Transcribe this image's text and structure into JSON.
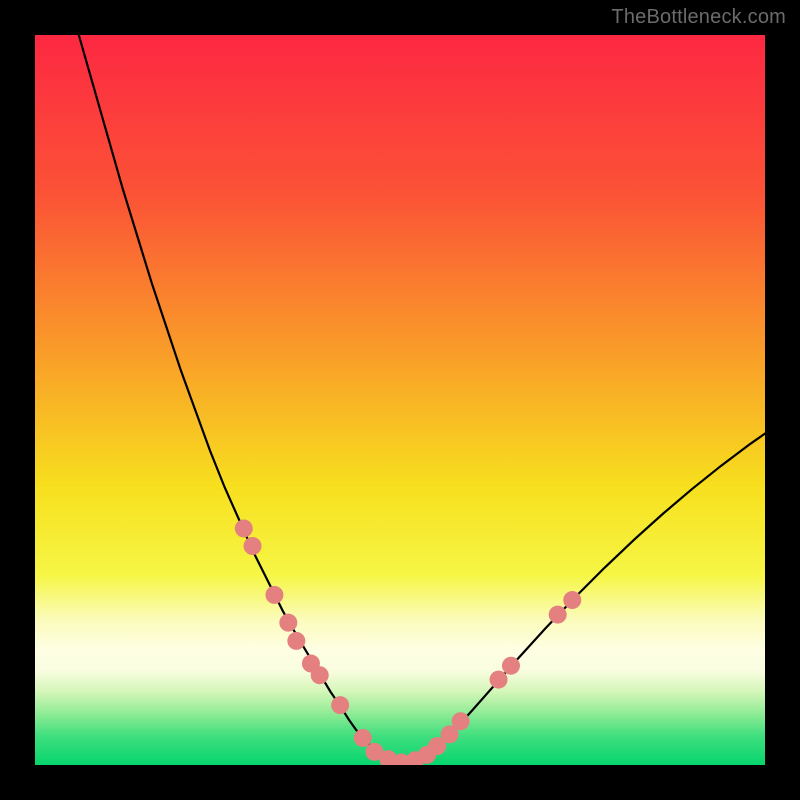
{
  "watermark": "TheBottleneck.com",
  "chart_data": {
    "type": "line",
    "title": "",
    "xlabel": "",
    "ylabel": "",
    "xlim": [
      0,
      100
    ],
    "ylim": [
      0,
      100
    ],
    "grid": false,
    "legend": false,
    "background_gradient": {
      "stops": [
        {
          "offset": 0.0,
          "color": "#fd2842"
        },
        {
          "offset": 0.22,
          "color": "#fb5336"
        },
        {
          "offset": 0.45,
          "color": "#f9a228"
        },
        {
          "offset": 0.62,
          "color": "#f7e01e"
        },
        {
          "offset": 0.74,
          "color": "#f6f646"
        },
        {
          "offset": 0.8,
          "color": "#fbfbba"
        },
        {
          "offset": 0.84,
          "color": "#fefee2"
        },
        {
          "offset": 0.87,
          "color": "#fafde0"
        },
        {
          "offset": 0.9,
          "color": "#d3f6b7"
        },
        {
          "offset": 0.93,
          "color": "#8eeb95"
        },
        {
          "offset": 0.96,
          "color": "#40df7e"
        },
        {
          "offset": 1.0,
          "color": "#06d56e"
        }
      ]
    },
    "series": [
      {
        "name": "bottleneck-curve",
        "color": "#000000",
        "width": 2.2,
        "x": [
          6,
          8,
          10,
          12,
          14,
          16,
          18,
          20,
          22,
          24,
          26,
          28,
          30,
          32,
          34,
          36,
          37.5,
          39,
          40.5,
          42,
          43,
          44,
          45,
          46,
          47,
          48,
          50,
          52,
          54,
          56,
          58,
          60,
          63,
          66,
          70,
          74,
          78,
          82,
          86,
          90,
          94,
          98,
          100
        ],
        "y": [
          100,
          93,
          86,
          79,
          72.5,
          66,
          60,
          54,
          48.5,
          43,
          38,
          33.5,
          29,
          25,
          21,
          17.5,
          15,
          12.5,
          10,
          7.8,
          6.2,
          4.8,
          3.6,
          2.6,
          1.8,
          1.1,
          0.35,
          0.6,
          1.7,
          3.4,
          5.4,
          7.6,
          11,
          14.4,
          18.8,
          23,
          27,
          30.8,
          34.4,
          37.8,
          41,
          44,
          45.4
        ]
      }
    ],
    "markers": {
      "name": "highlight-dots",
      "color": "#e48080",
      "radius": 9,
      "points": [
        {
          "x": 28.6,
          "y": 32.4
        },
        {
          "x": 29.8,
          "y": 30.0
        },
        {
          "x": 32.8,
          "y": 23.3
        },
        {
          "x": 34.7,
          "y": 19.5
        },
        {
          "x": 35.8,
          "y": 17.0
        },
        {
          "x": 37.8,
          "y": 13.9
        },
        {
          "x": 39.0,
          "y": 12.3
        },
        {
          "x": 41.8,
          "y": 8.2
        },
        {
          "x": 44.9,
          "y": 3.7
        },
        {
          "x": 46.5,
          "y": 1.8
        },
        {
          "x": 48.4,
          "y": 0.8
        },
        {
          "x": 50.2,
          "y": 0.35
        },
        {
          "x": 52.1,
          "y": 0.65
        },
        {
          "x": 53.7,
          "y": 1.4
        },
        {
          "x": 55.1,
          "y": 2.6
        },
        {
          "x": 56.8,
          "y": 4.2
        },
        {
          "x": 58.3,
          "y": 6.0
        },
        {
          "x": 63.5,
          "y": 11.7
        },
        {
          "x": 65.2,
          "y": 13.6
        },
        {
          "x": 71.6,
          "y": 20.6
        },
        {
          "x": 73.6,
          "y": 22.6
        }
      ]
    }
  }
}
